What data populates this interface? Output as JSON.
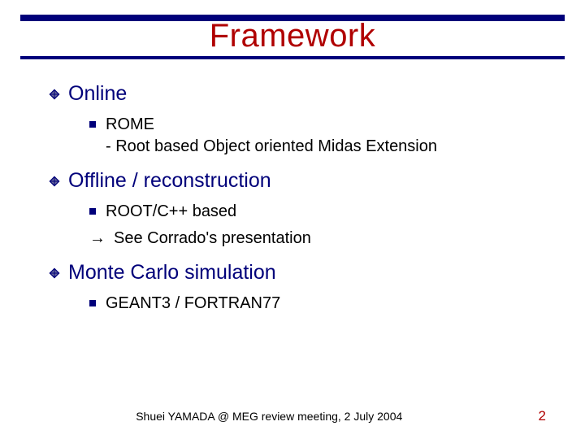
{
  "title": "Framework",
  "sections": [
    {
      "heading": "Online",
      "items": [
        {
          "text": "ROME\n- Root based Object oriented Midas Extension"
        }
      ]
    },
    {
      "heading": "Offline / reconstruction",
      "items": [
        {
          "text": "ROOT/C++ based"
        }
      ],
      "arrow_note": "See Corrado's presentation"
    },
    {
      "heading": "Monte Carlo simulation",
      "items": [
        {
          "text": "GEANT3 / FORTRAN77"
        }
      ]
    }
  ],
  "footer": {
    "center": "Shuei YAMADA @ MEG review meeting, 2 July 2004",
    "page": "2"
  }
}
